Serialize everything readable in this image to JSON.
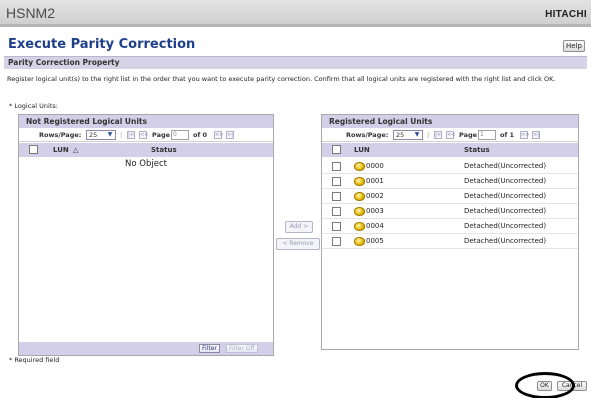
{
  "app": {
    "title": "HSNM2",
    "brand": "HITACHI"
  },
  "page": {
    "title": "Execute Parity Correction",
    "help_label": "Help"
  },
  "section": {
    "title": "Parity Correction Property",
    "instructions": "Register logical unit(s) to the right list in the order that you want to execute parity correction. Confirm that all logical units are registered with the right list and click OK.",
    "logical_units_label": "* Logical Units:"
  },
  "left_panel": {
    "title": "Not Registered Logical Units",
    "rows_per_page_label": "Rows/Page:",
    "rows_per_page_value": "25",
    "page_label": "Page",
    "page_value": "0",
    "page_of": "of 0",
    "columns": {
      "lun": "LUN",
      "lun_sort": "△",
      "status": "Status"
    },
    "empty_text": "No Object",
    "filter_label": "Filter",
    "filter_off_label": "Filter Off"
  },
  "middle": {
    "add_label": "Add >",
    "remove_label": "< Remove"
  },
  "right_panel": {
    "title": "Registered Logical Units",
    "rows_per_page_label": "Rows/Page:",
    "rows_per_page_value": "25",
    "page_label": "Page",
    "page_value": "1",
    "page_of": "of 1",
    "columns": {
      "lun": "LUN",
      "status": "Status"
    },
    "rows": [
      {
        "lun": "0000",
        "status": "Detached(Uncorrected)"
      },
      {
        "lun": "0001",
        "status": "Detached(Uncorrected)"
      },
      {
        "lun": "0002",
        "status": "Detached(Uncorrected)"
      },
      {
        "lun": "0003",
        "status": "Detached(Uncorrected)"
      },
      {
        "lun": "0004",
        "status": "Detached(Uncorrected)"
      },
      {
        "lun": "0005",
        "status": "Detached(Uncorrected)"
      }
    ]
  },
  "footer": {
    "required_note": "* Required field",
    "ok_label": "OK",
    "cancel_label": "Cancel"
  },
  "icons": {
    "nav_first": "first-page-icon",
    "nav_prev": "prev-page-icon",
    "nav_next": "next-page-icon",
    "nav_last": "last-page-icon",
    "lu": "logical-unit-disk-icon",
    "dropdown": "chevron-down-icon"
  },
  "colors": {
    "title": "#1f3f8a",
    "header_bar": "#d3cfe8",
    "disk": "#e6b800"
  }
}
